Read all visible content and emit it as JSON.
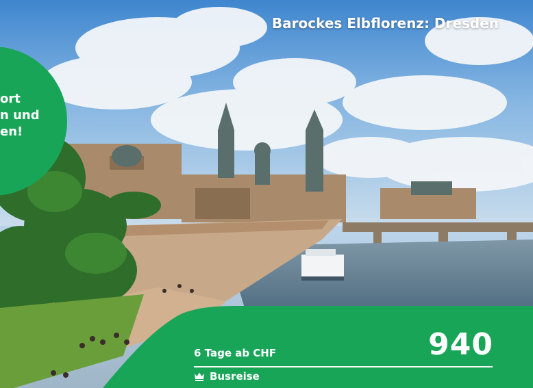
{
  "card": {
    "title": "Barockes Elbflorenz: Dresden",
    "image_subject": "dresden-skyline",
    "badge": {
      "lines": [
        "ort",
        "n und",
        "en!"
      ],
      "color": "#18a558"
    },
    "offer": {
      "duration_label": "6 Tage ab CHF",
      "price": "940",
      "travel_type": "Busreise",
      "travel_type_icon": "crown-icon"
    },
    "colors": {
      "accent_green": "#18a558",
      "text": "#ffffff"
    }
  }
}
